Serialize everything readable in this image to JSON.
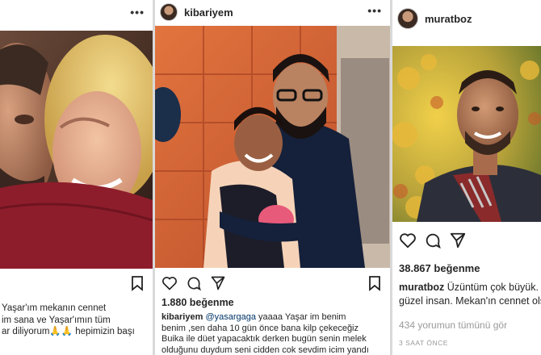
{
  "post1": {
    "caption_lines": [
      "Yaşar'ım mekanın cennet",
      "im sana ve Yaşar'ımın tüm",
      "ar diliyorum🙏🙏 hepimizin başı"
    ]
  },
  "post2": {
    "username": "kibariyem",
    "likes": "1.880 beğenme",
    "caption_user": "kibariyem",
    "mention": "@yasargaga",
    "caption_first": " yaaaa Yaşar im benim",
    "caption_lines": [
      "benim ,sen  daha 10 gün önce bana kilp çekeceğiz",
      "Buika ile düet yapacaktık derken bugün senin melek",
      "olduğunu duydum seni cidden cok sevdim icim yandı"
    ]
  },
  "post3": {
    "username": "muratboz",
    "likes": "38.867 beğenme",
    "caption_user": "muratboz",
    "caption_first": " Üzüntüm çok büyük. Nu",
    "caption_second": "güzel insan. Mekan'ın cennet olsun",
    "comments_link": "434 yorumun tümünü gör",
    "time": "3 SAAT ÖNCE"
  },
  "icons": [
    "more-icon",
    "heart-icon",
    "comment-icon",
    "share-icon",
    "bookmark-icon"
  ]
}
